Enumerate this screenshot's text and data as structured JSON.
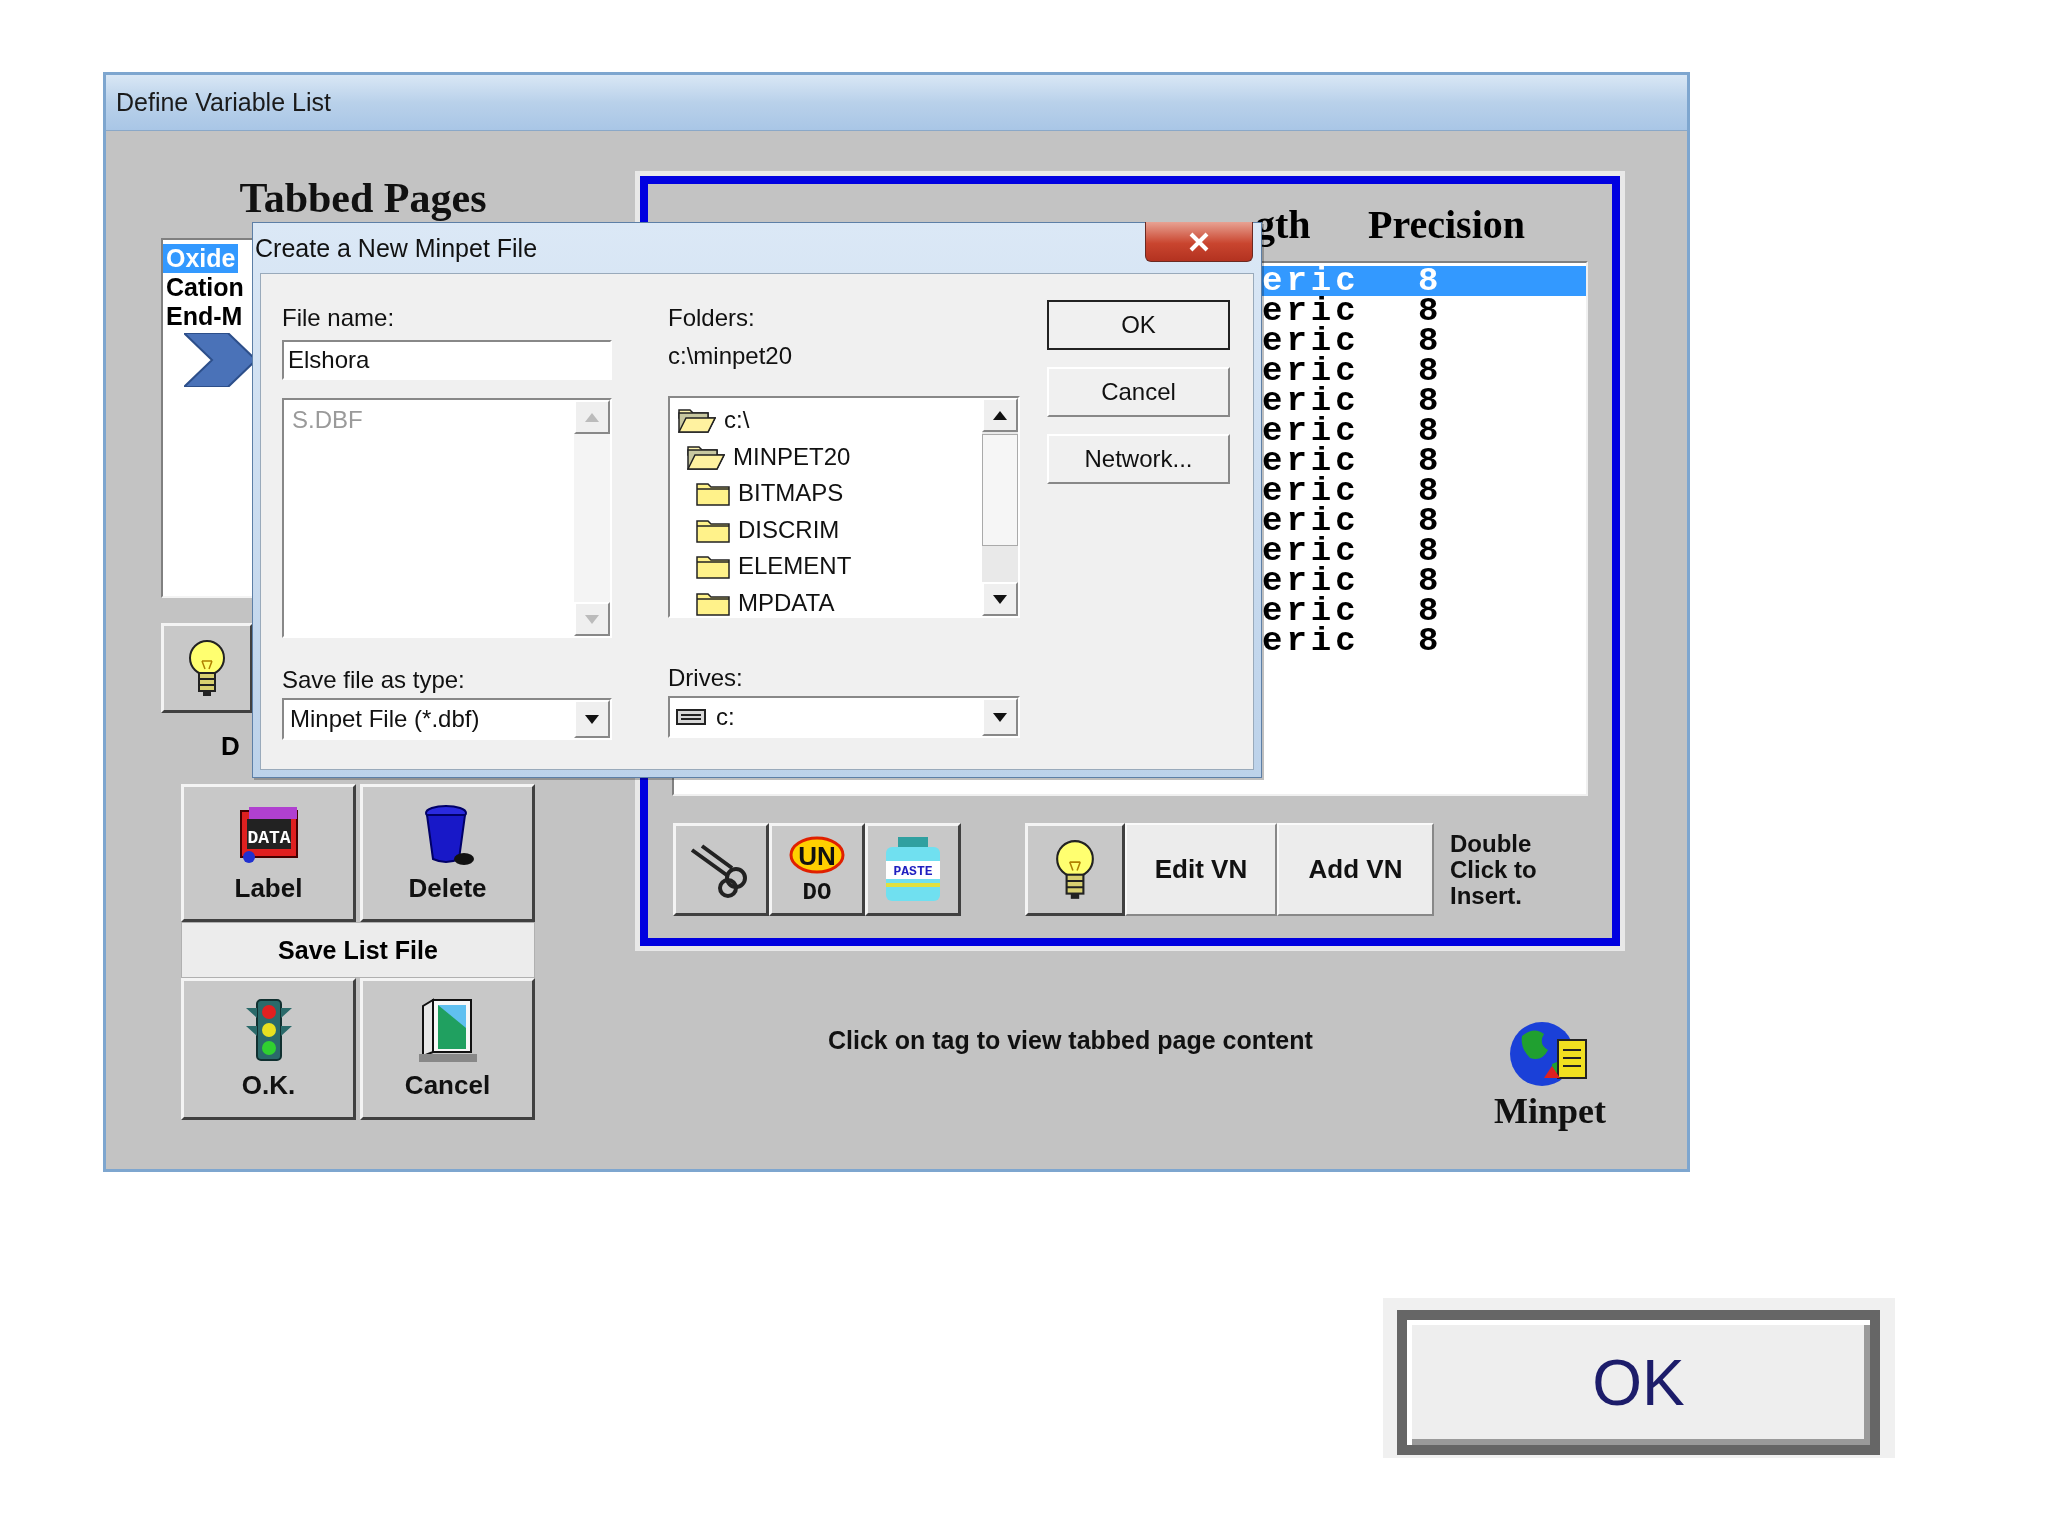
{
  "window": {
    "title": "Define Variable List"
  },
  "tabbed_pages": {
    "heading": "Tabbed Pages",
    "items": [
      {
        "label": "Oxide",
        "selected": true
      },
      {
        "label": "Cation",
        "selected": false
      },
      {
        "label": "End-M",
        "selected": false
      }
    ],
    "hint_caption": "D"
  },
  "left_buttons": [
    {
      "kind": "data",
      "label": "Label",
      "icon_text": "DATA"
    },
    {
      "kind": "trash",
      "label": "Delete"
    }
  ],
  "save_list_file": "Save List File",
  "bottom_buttons": [
    {
      "kind": "traffic",
      "label": "O.K."
    },
    {
      "kind": "door",
      "label": "Cancel"
    }
  ],
  "variables": {
    "headers": [
      "gth",
      "Precision"
    ],
    "rows": [
      {
        "column_2": "eric",
        "column_3": "8",
        "selected": true
      },
      {
        "column_2": "eric",
        "column_3": "8",
        "selected": false
      },
      {
        "column_2": "eric",
        "column_3": "8",
        "selected": false
      },
      {
        "column_2": "eric",
        "column_3": "8",
        "selected": false
      },
      {
        "column_2": "eric",
        "column_3": "8",
        "selected": false
      },
      {
        "column_2": "eric",
        "column_3": "8",
        "selected": false
      },
      {
        "column_2": "eric",
        "column_3": "8",
        "selected": false
      },
      {
        "column_2": "eric",
        "column_3": "8",
        "selected": false
      },
      {
        "column_2": "eric",
        "column_3": "8",
        "selected": false
      },
      {
        "column_2": "eric",
        "column_3": "8",
        "selected": false
      },
      {
        "column_2": "eric",
        "column_3": "8",
        "selected": false
      },
      {
        "column_2": "eric",
        "column_3": "8",
        "selected": false
      },
      {
        "column_2": "eric",
        "column_3": "8",
        "selected": false
      }
    ]
  },
  "toolbar": {
    "tools": [
      {
        "kind": "cut"
      },
      {
        "kind": "undo",
        "text_top": "UN",
        "text_bottom": "DO"
      },
      {
        "kind": "paste",
        "text": "PASTE"
      }
    ],
    "edit_button": "Edit VN",
    "add_button": "Add VN",
    "note_lines": [
      "Double",
      "Click to",
      "Insert."
    ]
  },
  "status": "Click on tag to view tabbed page content",
  "logo": {
    "text": "Minpet"
  },
  "dialog": {
    "title": "Create a New Minpet File",
    "file_name": {
      "label": "File name:",
      "value": "Elshora"
    },
    "file_list": {
      "disabled": true,
      "items": [
        "S.DBF"
      ]
    },
    "save_as_type": {
      "label": "Save file as type:",
      "value": "Minpet File (*.dbf)"
    },
    "folders": {
      "label": "Folders:",
      "path": "c:\\minpet20",
      "tree": [
        {
          "name": "c:\\",
          "open": true,
          "children": [
            {
              "name": "MINPET20",
              "open": true,
              "children": [
                {
                  "name": "BITMAPS",
                  "open": false
                },
                {
                  "name": "DISCRIM",
                  "open": false
                },
                {
                  "name": "ELEMENT",
                  "open": false
                },
                {
                  "name": "MPDATA",
                  "open": false
                }
              ]
            }
          ]
        }
      ]
    },
    "drives": {
      "label": "Drives:",
      "value": "c:"
    },
    "buttons": [
      "OK",
      "Cancel",
      "Network..."
    ]
  },
  "callout_button": {
    "label": "OK"
  }
}
